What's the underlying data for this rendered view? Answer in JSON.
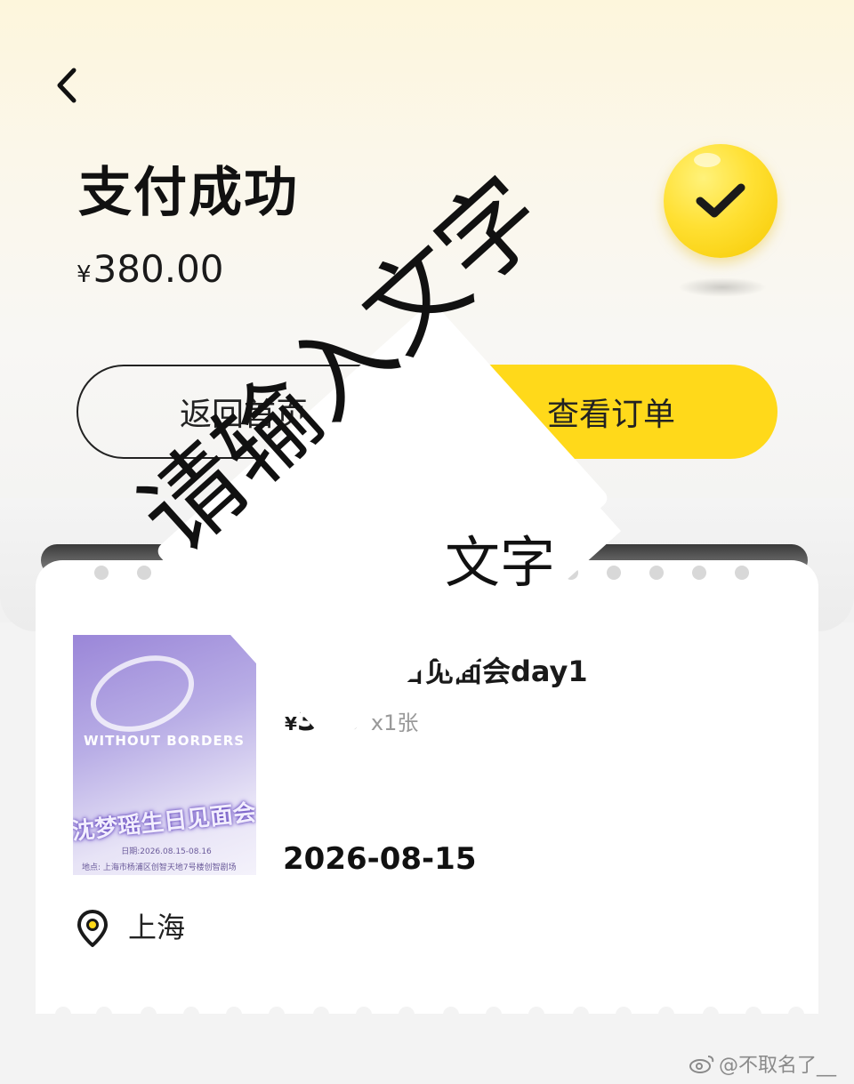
{
  "header": {
    "back_icon": "chevron-left-icon",
    "title": "支付成功",
    "currency": "¥",
    "amount": "380.00",
    "status_icon": "check-circle-icon"
  },
  "actions": {
    "home_label": "返回首页",
    "order_label": "查看订单"
  },
  "ticket": {
    "event_name": "沈梦瑶生日见面会day1",
    "currency": "¥",
    "price": "380",
    "quantity": "x1张",
    "date": "2026-08-15",
    "location": "上海",
    "poster": {
      "brand": "WITHOUT BORDERS",
      "title": "沈梦瑶生日见面会",
      "date_line": "日期:2026.08.15-08.16",
      "venue_line": "地点: 上海市杨浦区创智天地7号楼创智剧场"
    }
  },
  "overlay": {
    "text": "请输入文字",
    "text_small": "文字"
  },
  "footer": {
    "watermark": "@不取名了__"
  },
  "colors": {
    "accent": "#ffd91a",
    "text": "#111111",
    "muted": "#999999"
  }
}
